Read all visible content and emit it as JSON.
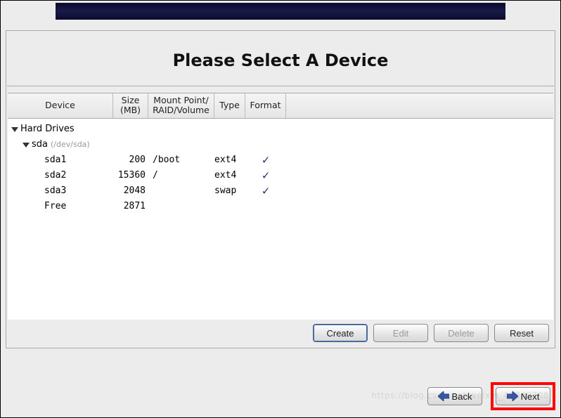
{
  "title": "Please Select A Device",
  "columns": {
    "device": "Device",
    "size": "Size\n(MB)",
    "mount": "Mount Point/\nRAID/Volume",
    "type": "Type",
    "format": "Format"
  },
  "tree": {
    "root_label": "Hard Drives",
    "disks": [
      {
        "name": "sda",
        "path": "(/dev/sda)",
        "partitions": [
          {
            "name": "sda1",
            "size_mb": "200",
            "mount": "/boot",
            "type": "ext4",
            "format": true
          },
          {
            "name": "sda2",
            "size_mb": "15360",
            "mount": "/",
            "type": "ext4",
            "format": true
          },
          {
            "name": "sda3",
            "size_mb": "2048",
            "mount": "",
            "type": "swap",
            "format": true
          },
          {
            "name": "Free",
            "size_mb": "2871",
            "mount": "",
            "type": "",
            "format": false
          }
        ]
      }
    ]
  },
  "buttons": {
    "create": "Create",
    "edit": "Edit",
    "delete": "Delete",
    "reset": "Reset",
    "back": "Back",
    "next": "Next"
  },
  "watermark": "https://blog.csdn.net/weixin_43849708"
}
